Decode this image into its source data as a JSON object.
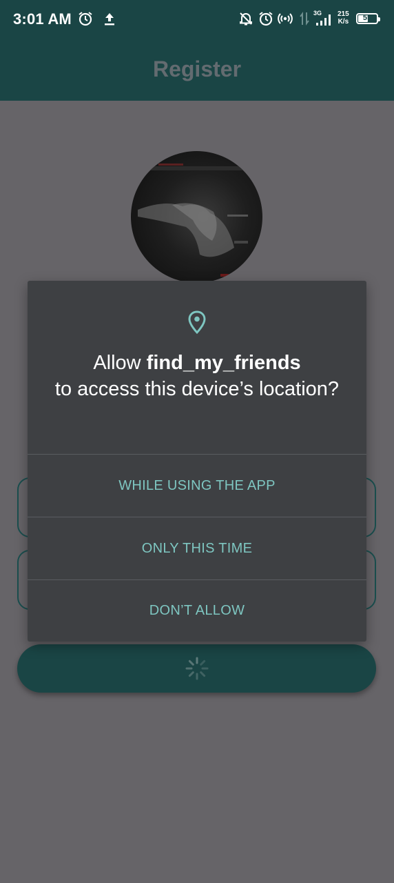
{
  "status_bar": {
    "time": "3:01 AM",
    "network_type": "3G",
    "speed_value": "215",
    "speed_unit": "K/s",
    "battery_level": "55",
    "icons": [
      "alarm-icon",
      "upload-icon",
      "notifications-off-icon",
      "alarm-icon",
      "hotspot-icon",
      "data-arrows-icon",
      "signal-icon",
      "battery-icon"
    ]
  },
  "app_bar": {
    "title": "Register"
  },
  "dialog": {
    "icon": "location-pin-icon",
    "message_prefix": "Allow ",
    "app_name": "find_my_friends",
    "message_suffix": " to access this device’s location?",
    "options": [
      {
        "label": "WHILE USING THE APP"
      },
      {
        "label": "ONLY THIS TIME"
      },
      {
        "label": "DON’T ALLOW"
      }
    ]
  },
  "colors": {
    "primary": "#1a4545",
    "scrim": "#666468",
    "dialog_bg": "#3e4043",
    "accent": "#7ec6c1"
  }
}
